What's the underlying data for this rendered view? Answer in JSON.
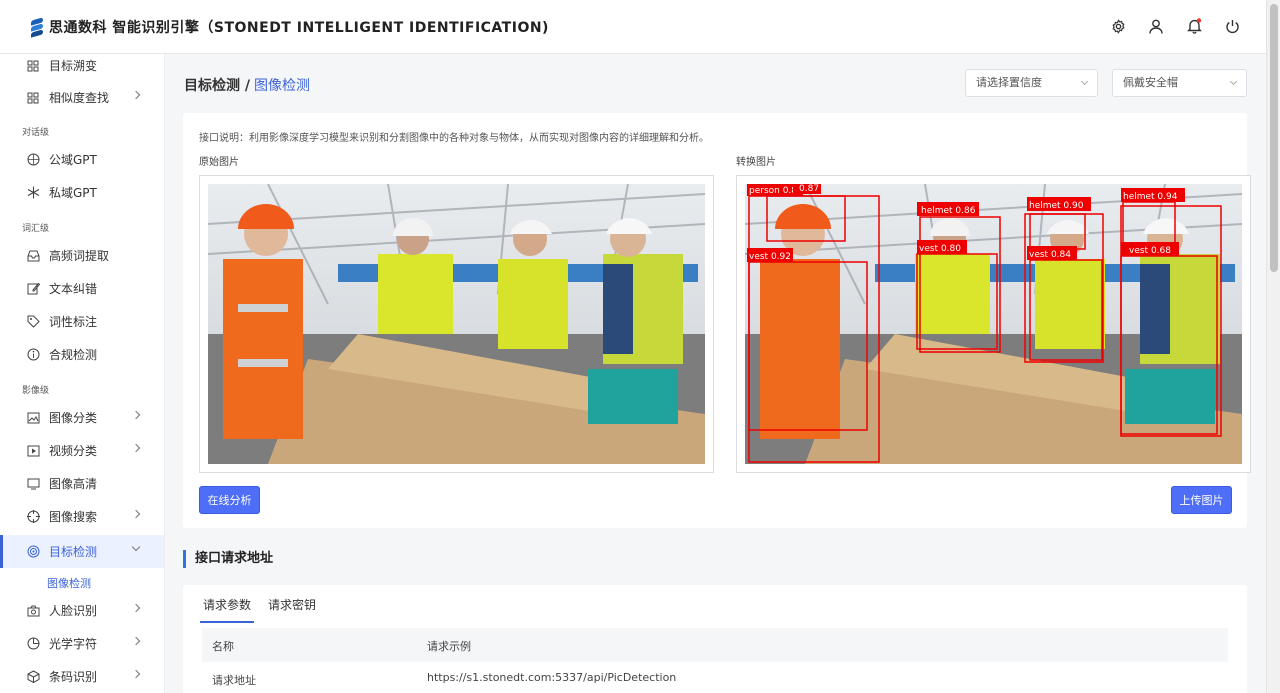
{
  "header": {
    "brand": "思通数科 智能识别引擎（STONEDT INTELLIGENT IDENTIFICATION)",
    "icons": [
      "gear-icon",
      "user-icon",
      "bell-icon",
      "power-icon"
    ],
    "accent": "#3b63d8"
  },
  "sidebar": {
    "items": [
      {
        "label": "目标溯变",
        "icon": "grid-icon",
        "chevron": false
      },
      {
        "label": "相似度查找",
        "icon": "grid-icon",
        "chevron": true
      },
      {
        "label": "公域GPT",
        "icon": "aperture-icon",
        "chevron": false
      },
      {
        "label": "私域GPT",
        "icon": "snowflake-icon",
        "chevron": false
      },
      {
        "label": "高频词提取",
        "icon": "inbox-icon",
        "chevron": false
      },
      {
        "label": "文本纠错",
        "icon": "edit-icon",
        "chevron": false
      },
      {
        "label": "词性标注",
        "icon": "tag-icon",
        "chevron": false
      },
      {
        "label": "合规检测",
        "icon": "info-icon",
        "chevron": false
      },
      {
        "label": "图像分类",
        "icon": "image-icon",
        "chevron": true
      },
      {
        "label": "视频分类",
        "icon": "video-icon",
        "chevron": true
      },
      {
        "label": "图像高清",
        "icon": "monitor-icon",
        "chevron": false
      },
      {
        "label": "图像搜索",
        "icon": "crosshair-icon",
        "chevron": true
      },
      {
        "label": "目标检测",
        "icon": "target-icon",
        "chevron": true
      },
      {
        "label": "人脸识别",
        "icon": "camera-icon",
        "chevron": true
      },
      {
        "label": "光学字符",
        "icon": "pie-icon",
        "chevron": true
      },
      {
        "label": "条码识别",
        "icon": "box-icon",
        "chevron": true
      }
    ],
    "groups": [
      "对话级",
      "词汇级",
      "影像级"
    ],
    "sub_item": "图像检测"
  },
  "main": {
    "breadcrumb_parent": "目标检测 /",
    "breadcrumb_current": "图像检测",
    "select_confidence_placeholder": "请选择置信度",
    "select_class_value": "佩戴安全帽",
    "description": "接口说明：利用影像深度学习模型来识别和分割图像中的各种对象与物体，从而实现对图像内容的详细理解和分析。",
    "original_label": "原始图片",
    "converted_label": "转换图片",
    "analyze_button": "在线分析",
    "upload_button": "上传图片",
    "detections": [
      {
        "label": "person 0.87",
        "label2": "0.87"
      },
      {
        "label": "vest 0.92"
      },
      {
        "label": "helmet 0.86"
      },
      {
        "label": "vest 0.80"
      },
      {
        "label": "helmet 0.90"
      },
      {
        "label": "vest 0.84"
      },
      {
        "label": "helmet 0.94"
      },
      {
        "label": "vest 0.68"
      }
    ]
  },
  "api": {
    "section_title": "接口请求地址",
    "tabs": [
      "请求参数",
      "请求密钥"
    ],
    "columns": [
      "名称",
      "请求示例"
    ],
    "rows": [
      {
        "name": "请求地址",
        "value": "https://s1.stonedt.com:5337/api/PicDetection"
      }
    ]
  }
}
